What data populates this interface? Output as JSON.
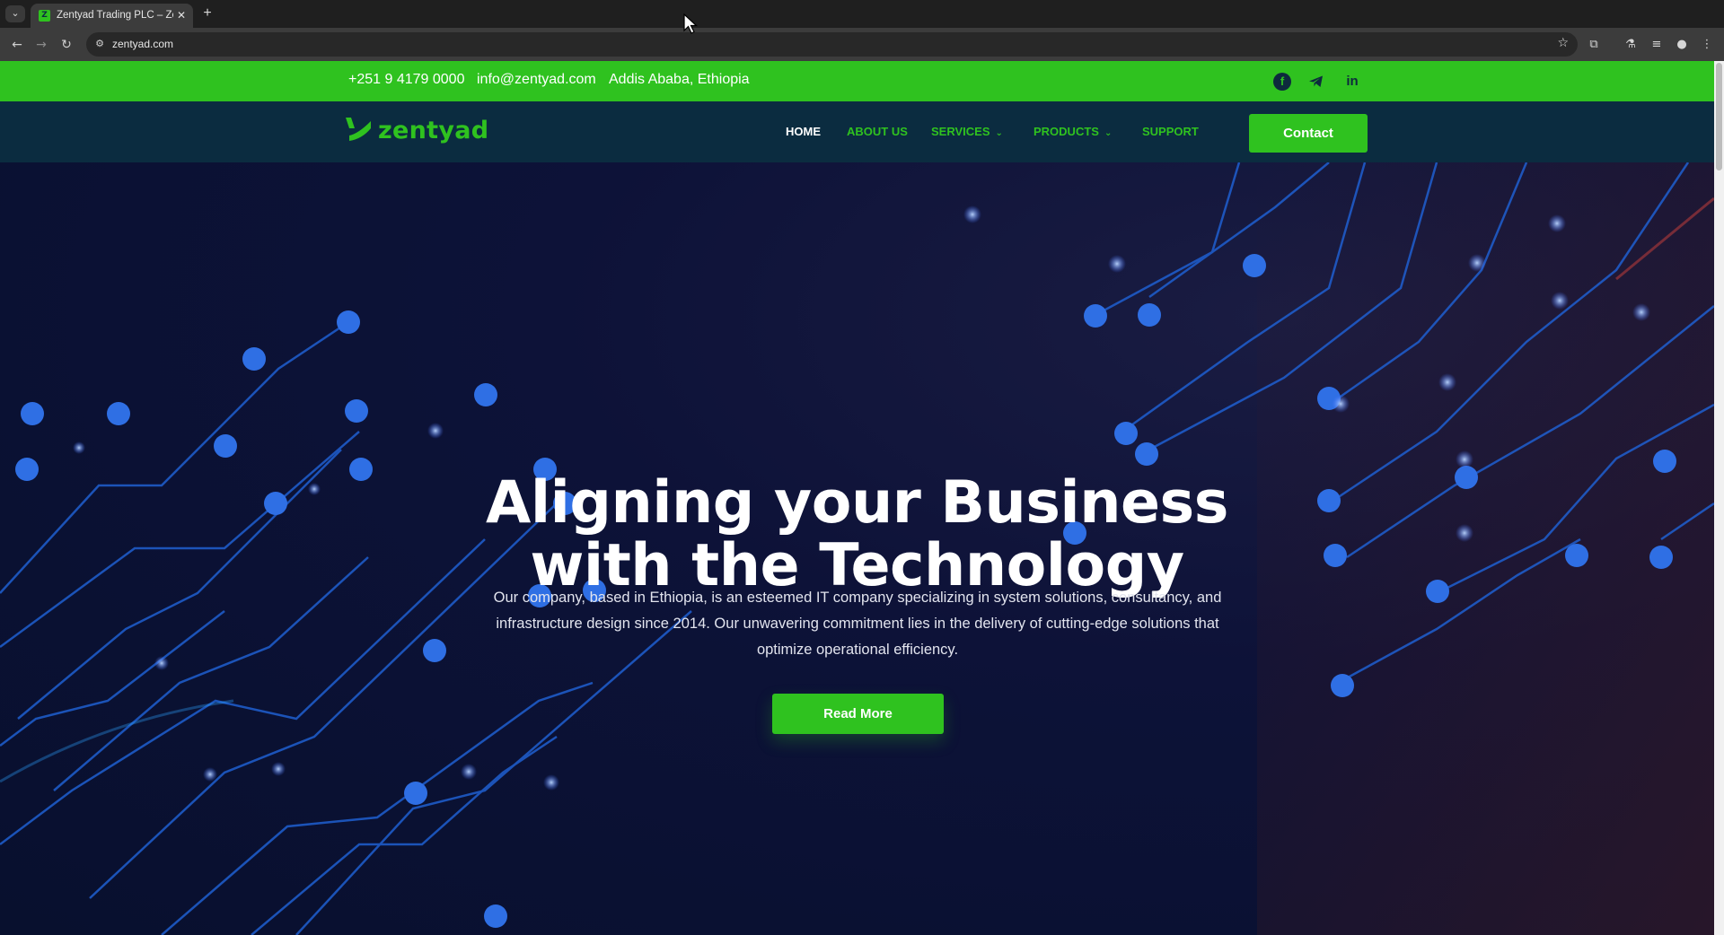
{
  "browser": {
    "tab_title": "Zentyad Trading PLC – Ze",
    "url": "zentyad.com",
    "icons": [
      "tab-list-icon",
      "close-icon",
      "new-tab-icon",
      "back-icon",
      "forward-icon",
      "reload-icon",
      "site-info-icon",
      "bookmark-star-icon",
      "extensions-icon",
      "labs-icon",
      "media-icon",
      "profile-icon",
      "menu-icon"
    ]
  },
  "topbar": {
    "phone": "+251 9 4179 0000",
    "email": "info@zentyad.com",
    "location": "Addis Ababa, Ethiopia",
    "social": [
      "facebook-icon",
      "telegram-icon",
      "linkedin-icon"
    ],
    "linkedin_text": "in",
    "facebook_text": "f"
  },
  "nav": {
    "logo_text": "zentyad",
    "links": [
      "HOME",
      "ABOUT US",
      "SERVICES",
      "PRODUCTS",
      "SUPPORT"
    ],
    "contact_label": "Contact"
  },
  "hero": {
    "title_line1": "Aligning your Business",
    "title_line2": "with the Technology",
    "description": "Our company, based in Ethiopia, is an esteemed IT company specializing in system solutions, consultancy, and infrastructure design since 2014. Our unwavering commitment lies in the delivery of cutting-edge solutions that optimize operational efficiency.",
    "button_label": "Read More"
  },
  "colors": {
    "brand_green": "#2fc21f",
    "nav_bg": "#0b2c40",
    "hero_bg": "#0b1236",
    "circuit_blue": "#1f5fd0"
  }
}
